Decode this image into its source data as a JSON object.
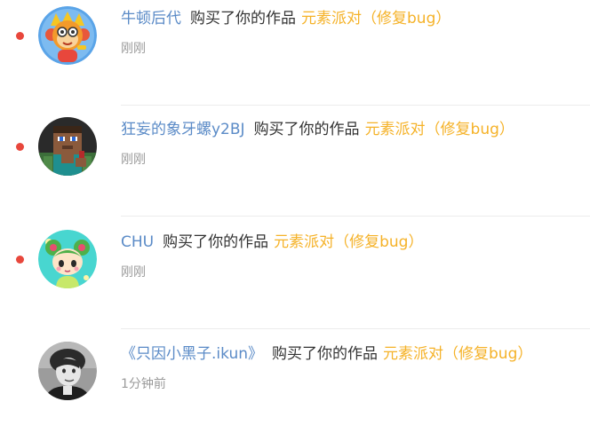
{
  "notifications": [
    {
      "user": "牛顿后代",
      "action": "购买了你的作品",
      "work": "元素派对（修复bug）",
      "time": "刚刚",
      "unread": true,
      "avatar_icon": "monkey-cartoon-avatar"
    },
    {
      "user": "狂妄的象牙螺y2BJ",
      "action": "购买了你的作品",
      "work": "元素派对（修复bug）",
      "time": "刚刚",
      "unread": true,
      "avatar_icon": "pixel-character-avatar"
    },
    {
      "user": "CHU",
      "action": "购买了你的作品",
      "work": "元素派对（修复bug）",
      "time": "刚刚",
      "unread": true,
      "avatar_icon": "green-cartoon-girl-avatar"
    },
    {
      "user": "《只因小黑子.ikun》",
      "action": "购买了你的作品",
      "work": "元素派对（修复bug）",
      "time": "1分钟前",
      "unread": false,
      "avatar_icon": "grayscale-photo-avatar"
    }
  ],
  "colors": {
    "user_link": "#5b8bc7",
    "work_link": "#f5b228",
    "unread_dot": "#e8473c",
    "time_text": "#9a9a9a"
  }
}
